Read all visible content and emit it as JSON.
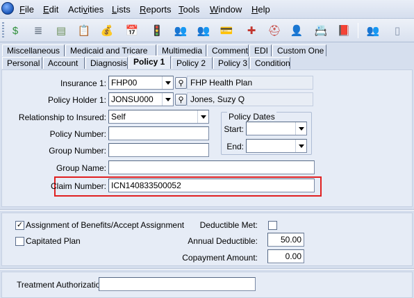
{
  "menu": {
    "items": [
      {
        "name": "menu-file",
        "pre": "",
        "u": "F",
        "post": "ile"
      },
      {
        "name": "menu-edit",
        "pre": "",
        "u": "E",
        "post": "dit"
      },
      {
        "name": "menu-activities",
        "pre": "Acti",
        "u": "v",
        "post": "ities"
      },
      {
        "name": "menu-lists",
        "pre": "",
        "u": "L",
        "post": "ists"
      },
      {
        "name": "menu-reports",
        "pre": "",
        "u": "R",
        "post": "eports"
      },
      {
        "name": "menu-tools",
        "pre": "",
        "u": "T",
        "post": "ools"
      },
      {
        "name": "menu-window",
        "pre": "",
        "u": "W",
        "post": "indow"
      },
      {
        "name": "menu-help",
        "pre": "",
        "u": "H",
        "post": "elp"
      }
    ]
  },
  "toolbar": {
    "icons": [
      {
        "name": "money-icon",
        "glyph": "$",
        "color": "#2f8f3a"
      },
      {
        "name": "document-stack-icon",
        "glyph": "≣",
        "color": "#5d6a7a"
      },
      {
        "name": "ledger-icon",
        "glyph": "▤",
        "color": "#6b8f5a"
      },
      {
        "name": "clipboard-icon",
        "glyph": "📋",
        "color": "#b08a2e"
      },
      {
        "name": "payment-icon",
        "glyph": "💰",
        "color": "#c48a1d"
      },
      {
        "name": "calendar-icon",
        "glyph": "📅",
        "color": "#b8322e"
      },
      {
        "name": "traffic-light-icon",
        "glyph": "🚦",
        "color": "#3a3a3a"
      },
      {
        "name": "patient-icon",
        "glyph": "👥",
        "color": "#6b4e2e"
      },
      {
        "name": "provider-icon",
        "glyph": "👥",
        "color": "#4d5e2e"
      },
      {
        "name": "card-icon",
        "glyph": "💳",
        "color": "#2c8a6e"
      },
      {
        "name": "medical-icon",
        "glyph": "✚",
        "color": "#c2362f"
      },
      {
        "name": "first-aid-icon",
        "glyph": "⛑",
        "color": "#c2362f"
      },
      {
        "name": "doctor-icon",
        "glyph": "👤",
        "color": "#6f7f9a"
      },
      {
        "name": "address-book-icon",
        "glyph": "📇",
        "color": "#8a6a3a"
      },
      {
        "name": "book-icon",
        "glyph": "📕",
        "color": "#8c2f2f"
      },
      {
        "name": "users-icon",
        "glyph": "👥",
        "color": "#7a5a2e"
      },
      {
        "name": "door-icon",
        "glyph": "▯",
        "color": "#8896ad"
      }
    ]
  },
  "tabs": {
    "row1": [
      "Miscellaneous",
      "Medicaid and Tricare",
      "Multimedia",
      "Comment",
      "EDI",
      "Custom One"
    ],
    "row2": [
      "Personal",
      "Account",
      "Diagnosis",
      "Policy 1",
      "Policy 2",
      "Policy 3",
      "Condition"
    ]
  },
  "form": {
    "insurance_label": "Insurance 1:",
    "insurance_code": "FHP00",
    "insurance_name": "FHP Health Plan",
    "policy_holder_label": "Policy Holder 1:",
    "policy_holder_code": "JONSU000",
    "policy_holder_name": "Jones, Suzy Q",
    "relationship_label": "Relationship to Insured:",
    "relationship_value": "Self",
    "policy_number_label": "Policy Number:",
    "policy_number_value": "",
    "group_number_label": "Group Number:",
    "group_number_value": "",
    "group_name_label": "Group Name:",
    "group_name_value": "",
    "claim_number_label": "Claim Number:",
    "claim_number_value": "ICN140833500052",
    "policy_dates_legend": "Policy Dates",
    "start_label": "Start:",
    "start_value": "",
    "end_label": "End:",
    "end_value": ""
  },
  "benefits": {
    "assignment_label": "Assignment of Benefits/Accept Assignment",
    "assignment_checked": "✓",
    "capitated_label": "Capitated Plan",
    "capitated_checked": "",
    "deductible_met_label": "Deductible Met:",
    "deductible_met_checked": "",
    "annual_deductible_label": "Annual Deductible:",
    "annual_deductible_value": "50.00",
    "copayment_label": "Copayment Amount:",
    "copayment_value": "0.00"
  },
  "treatment": {
    "label": "Treatment Authorization:",
    "value": ""
  },
  "colors": {
    "highlight_border": "#e02020"
  }
}
